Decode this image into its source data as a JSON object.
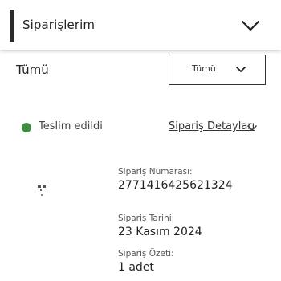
{
  "header": {
    "title": "Siparişlerim",
    "toggle_icon": "chevron-down-icon"
  },
  "filter": {
    "label": "Tümü",
    "selected": "Tümü",
    "dropdown_icon": "chevron-down-icon"
  },
  "order": {
    "status": "Teslim edildi",
    "status_color": "#3e8e41",
    "details_link": "Sipariş Detayları",
    "order_number_label": "Sipariş Numarası:",
    "order_number": "2771416425621324",
    "order_date_label": "Sipariş Tarihi:",
    "order_date": "23 Kasım 2024",
    "summary_label": "Sipariş Özeti:",
    "summary_value": "1 adet"
  }
}
